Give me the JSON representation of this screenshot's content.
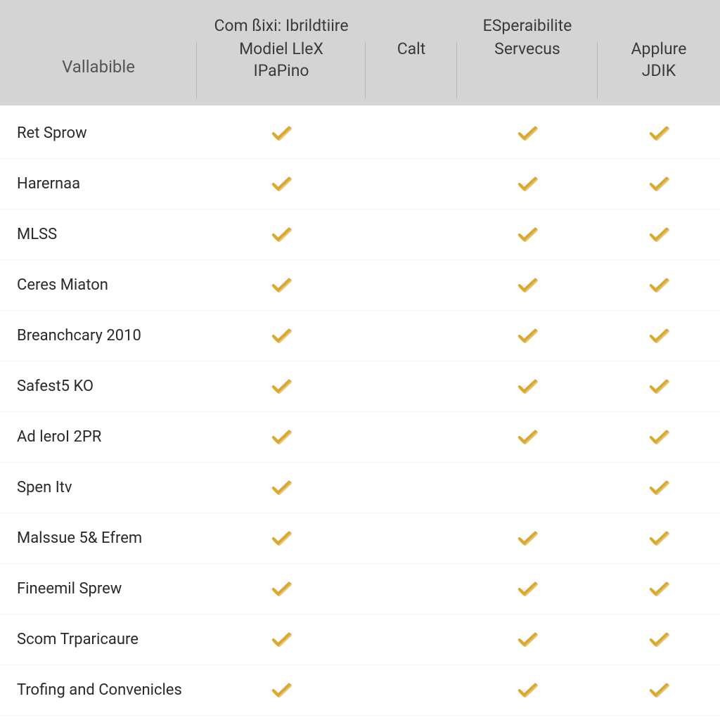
{
  "header": {
    "top_label": "Vallabible",
    "group_left": "Com ßixi: Ibrildtiire",
    "group_right": "ESperaibilite",
    "col1": "Modiel LleX\nIPaPino",
    "col2": "Calt",
    "col3": "Servecus",
    "col4": "Applure\nJDIK"
  },
  "rows": [
    {
      "label": "Ret Sprow",
      "c1": true,
      "c2": false,
      "c3": true,
      "c4": true
    },
    {
      "label": "Harernaa",
      "c1": true,
      "c2": false,
      "c3": true,
      "c4": true
    },
    {
      "label": "MLSS",
      "c1": true,
      "c2": false,
      "c3": true,
      "c4": true
    },
    {
      "label": "Ceres Miaton",
      "c1": true,
      "c2": false,
      "c3": true,
      "c4": true
    },
    {
      "label": "Breanchcary 2010",
      "c1": true,
      "c2": false,
      "c3": true,
      "c4": true
    },
    {
      "label": "Safest5 KO",
      "c1": true,
      "c2": false,
      "c3": true,
      "c4": true
    },
    {
      "label": "Ad leroI 2PR",
      "c1": true,
      "c2": false,
      "c3": true,
      "c4": true
    },
    {
      "label": "Spen Itv",
      "c1": true,
      "c2": false,
      "c3": false,
      "c4": true
    },
    {
      "label": "Malssue 5& Efrem",
      "c1": true,
      "c2": false,
      "c3": true,
      "c4": true
    },
    {
      "label": "Fineemil Sprew",
      "c1": true,
      "c2": false,
      "c3": true,
      "c4": true
    },
    {
      "label": "Scom Trparicaure",
      "c1": true,
      "c2": false,
      "c3": true,
      "c4": true
    },
    {
      "label": "Trofing and Convenicles",
      "c1": true,
      "c2": false,
      "c3": true,
      "c4": true
    }
  ],
  "icons": {
    "check_fill": "#e0a826",
    "check_shadow": "#d7c79a"
  }
}
